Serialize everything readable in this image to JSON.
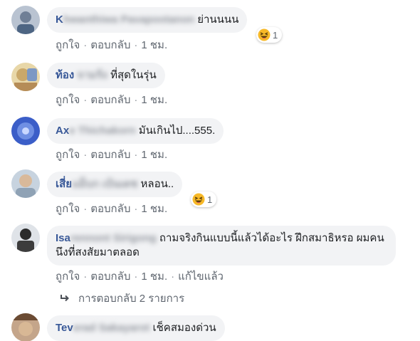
{
  "colors": {
    "author": "#385898",
    "bubble": "#f2f3f5",
    "meta": "#606770"
  },
  "comments": [
    {
      "author_visible": "K",
      "author_blurred": "hwanthiwa Pavapootanon",
      "text": "ย่านนนน",
      "actions": {
        "like": "ถูกใจ",
        "reply": "ตอบกลับ",
        "time": "1 ชม."
      },
      "reaction": {
        "icon": "laughing-emoji-icon",
        "count": "1"
      }
    },
    {
      "author_visible": "ท้อง",
      "author_blurred": " จามร้ง",
      "text": "ที่สุดในรุ่น",
      "actions": {
        "like": "ถูกใจ",
        "reply": "ตอบกลับ",
        "time": "1 ชม."
      }
    },
    {
      "author_visible": "Ax",
      "author_blurred": "e Thichakorn",
      "text": "มันเกินไป....555.",
      "actions": {
        "like": "ถูกใจ",
        "reply": "ตอบกลับ",
        "time": "1 ชม."
      }
    },
    {
      "author_visible": "เสี่ย",
      "author_blurred": "แม็บก เบ้นเดช",
      "text": "หลอน..",
      "actions": {
        "like": "ถูกใจ",
        "reply": "ตอบกลับ",
        "time": "1 ชม."
      },
      "reaction": {
        "icon": "laughing-emoji-icon",
        "count": "1"
      }
    },
    {
      "author_visible": "Isa",
      "author_blurred": "rennont Sirigong",
      "text": "ถามจริงกินแบบนี้แล้วได้อะไร ฝึกสมาธิหรอ ผมคนนึงที่สงสัยมาตลอด",
      "actions": {
        "like": "ถูกใจ",
        "reply": "ตอบกลับ",
        "time": "1 ชม.",
        "edited": "แก้ไขแล้ว"
      }
    },
    {
      "author_visible": "Tev",
      "author_blurred": "erad Sakayarot",
      "text": "เช็คสมองด่วน"
    }
  ],
  "replies_link": {
    "label": "การตอบกลับ 2 รายการ"
  }
}
